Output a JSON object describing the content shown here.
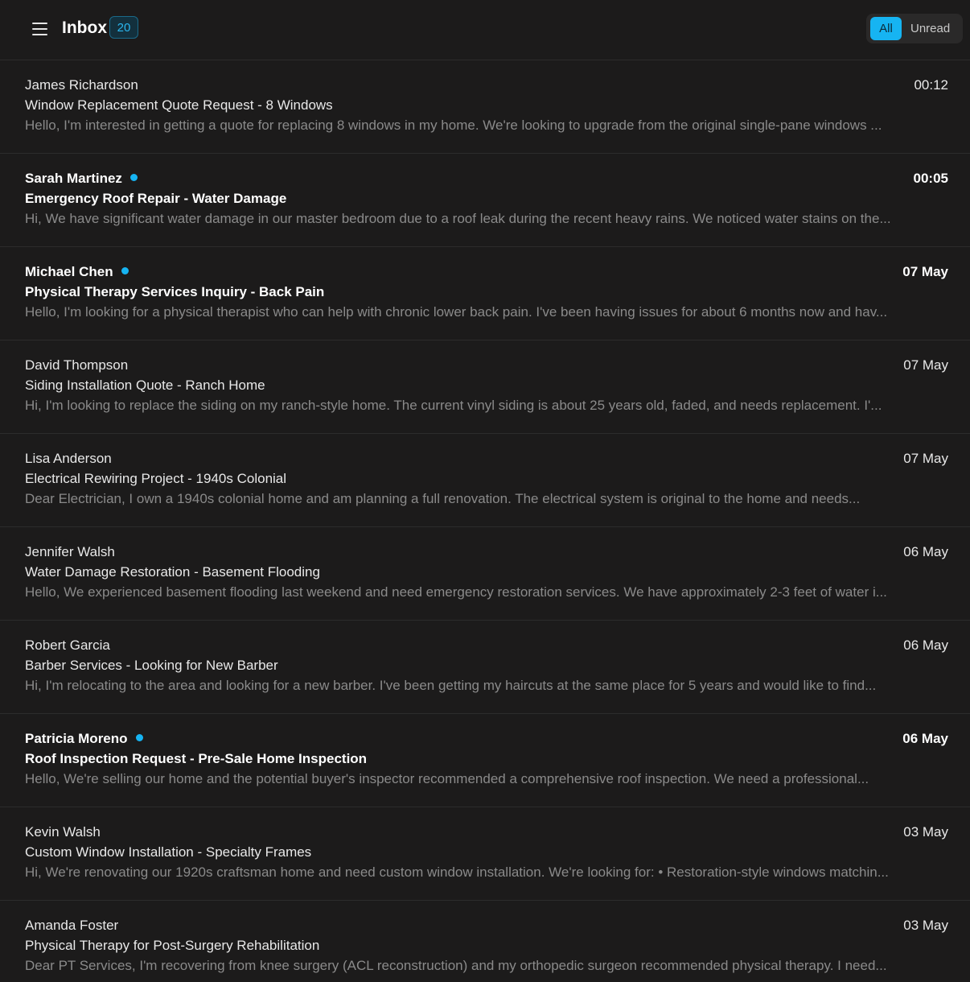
{
  "header": {
    "title": "Inbox",
    "count": "20",
    "filters": {
      "all": "All",
      "unread": "Unread"
    }
  },
  "colors": {
    "accent": "#16b4f2",
    "background": "#1c1b1b",
    "text": "#e8e8e8",
    "muted": "#8a8a8a"
  },
  "icons": {
    "menu": "hamburger-menu-icon",
    "unread": "unread-dot-icon"
  },
  "messages": [
    {
      "sender": "James Richardson",
      "time": "00:12",
      "subject": "Window Replacement Quote Request - 8 Windows",
      "preview": "Hello, I'm interested in getting a quote for replacing 8 windows in my home. We're looking to upgrade from the original single-pane windows ...",
      "unread": false
    },
    {
      "sender": "Sarah Martinez",
      "time": "00:05",
      "subject": "Emergency Roof Repair - Water Damage",
      "preview": "Hi, We have significant water damage in our master bedroom due to a roof leak during the recent heavy rains. We noticed water stains on the...",
      "unread": true
    },
    {
      "sender": "Michael Chen",
      "time": "07 May",
      "subject": "Physical Therapy Services Inquiry - Back Pain",
      "preview": "Hello, I'm looking for a physical therapist who can help with chronic lower back pain. I've been having issues for about 6 months now and hav...",
      "unread": true
    },
    {
      "sender": "David Thompson",
      "time": "07 May",
      "subject": "Siding Installation Quote - Ranch Home",
      "preview": "Hi, I'm looking to replace the siding on my ranch-style home. The current vinyl siding is about 25 years old, faded, and needs replacement. I'...",
      "unread": false
    },
    {
      "sender": "Lisa Anderson",
      "time": "07 May",
      "subject": "Electrical Rewiring Project - 1940s Colonial",
      "preview": "Dear Electrician, I own a 1940s colonial home and am planning a full renovation. The electrical system is original to the home and needs...",
      "unread": false
    },
    {
      "sender": "Jennifer Walsh",
      "time": "06 May",
      "subject": "Water Damage Restoration - Basement Flooding",
      "preview": "Hello, We experienced basement flooding last weekend and need emergency restoration services. We have approximately 2-3 feet of water i...",
      "unread": false
    },
    {
      "sender": "Robert Garcia",
      "time": "06 May",
      "subject": "Barber Services - Looking for New Barber",
      "preview": "Hi, I'm relocating to the area and looking for a new barber. I've been getting my haircuts at the same place for 5 years and would like to find...",
      "unread": false
    },
    {
      "sender": "Patricia Moreno",
      "time": "06 May",
      "subject": "Roof Inspection Request - Pre-Sale Home Inspection",
      "preview": "Hello, We're selling our home and the potential buyer's inspector recommended a comprehensive roof inspection. We need a professional...",
      "unread": true
    },
    {
      "sender": "Kevin Walsh",
      "time": "03 May",
      "subject": "Custom Window Installation - Specialty Frames",
      "preview": "Hi, We're renovating our 1920s craftsman home and need custom window installation. We're looking for: • Restoration-style windows matchin...",
      "unread": false
    },
    {
      "sender": "Amanda Foster",
      "time": "03 May",
      "subject": "Physical Therapy for Post-Surgery Rehabilitation",
      "preview": "Dear PT Services, I'm recovering from knee surgery (ACL reconstruction) and my orthopedic surgeon recommended physical therapy. I need...",
      "unread": false
    }
  ]
}
